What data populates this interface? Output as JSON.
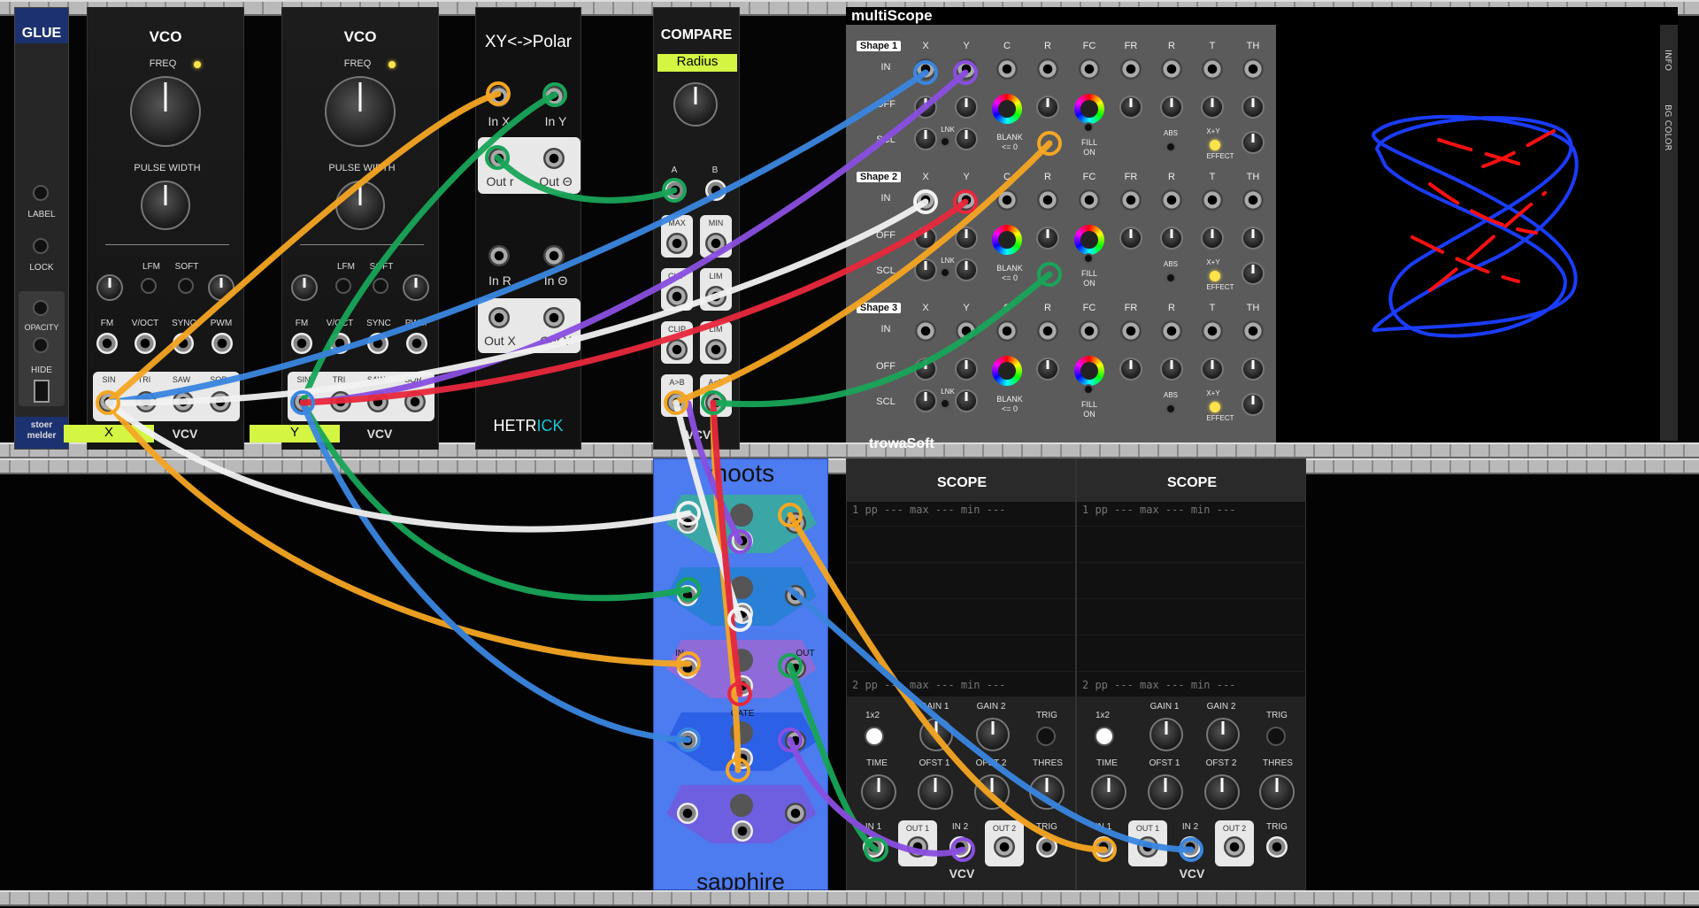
{
  "glue": {
    "title": "GLUE",
    "label": "LABEL",
    "lock": "LOCK",
    "opacity": "OPACITY",
    "hide": "HIDE",
    "brand_top": "stoer",
    "brand_bottom": "melder"
  },
  "vco1": {
    "title": "VCO",
    "freq": "FREQ",
    "pulse_width": "PULSE WIDTH",
    "lfm": "LFM",
    "soft": "SOFT",
    "inputs": [
      "FM",
      "V/OCT",
      "SYNC",
      "PWM"
    ],
    "outputs": [
      "SIN",
      "TRI",
      "SAW",
      "SQR"
    ],
    "tag": "X",
    "brand": "VCV"
  },
  "vco2": {
    "title": "VCO",
    "freq": "FREQ",
    "pulse_width": "PULSE WIDTH",
    "lfm": "LFM",
    "soft": "SOFT",
    "inputs": [
      "FM",
      "V/OCT",
      "SYNC",
      "PWM"
    ],
    "outputs": [
      "SIN",
      "TRI",
      "SAW",
      "SQR"
    ],
    "tag": "Y",
    "brand": "VCV"
  },
  "xypolar": {
    "title": "XY<->Polar",
    "in_x": "In X",
    "in_y": "In Y",
    "out_r": "Out r",
    "out_theta": "Out Θ",
    "in_r": "In R",
    "in_theta": "In Θ",
    "out_x": "Out X",
    "out_y": "Out Y",
    "brand_a": "HETR",
    "brand_b": "ICK"
  },
  "compare": {
    "title": "COMPARE",
    "mode": "Radius",
    "a": "A",
    "b": "B",
    "rows": [
      [
        "MAX",
        "MIN"
      ],
      [
        "CLIP",
        "LIM"
      ],
      [
        "CLIP",
        "LIM"
      ],
      [
        "A>B",
        "A<B"
      ]
    ],
    "brand": "VCV"
  },
  "multiscope": {
    "title": "multiScope",
    "info": "INFO",
    "bgcolor": "BG COLOR",
    "columns": [
      "X",
      "Y",
      "C",
      "R",
      "FC",
      "FR",
      "R",
      "T",
      "TH"
    ],
    "shapes": [
      "Shape 1",
      "Shape 2",
      "Shape 3"
    ],
    "row_in": "IN",
    "row_off": "OFF",
    "row_scl": "SCL",
    "lnk": "LNK",
    "blank": "BLANK",
    "blank2": "<= 0",
    "fill": "FILL",
    "fill2": "ON",
    "abs": "ABS",
    "xy": "X+Y",
    "effect": "EFFECT"
  },
  "trowasoft": {
    "title": "trowaSoft"
  },
  "moots": {
    "title": "moots",
    "in": "IN",
    "out": "OUT",
    "gate": "GATE",
    "brand": "sapphire"
  },
  "scope1": {
    "title": "SCOPE",
    "stat1": "1 pp --- max --- min ---",
    "stat2": "2 pp --- max --- min ---",
    "mode": "1x2",
    "gain1": "GAIN 1",
    "gain2": "GAIN 2",
    "trig": "TRIG",
    "time": "TIME",
    "ofst1": "OFST 1",
    "ofst2": "OFST 2",
    "thres": "THRES",
    "in1": "IN 1",
    "out1": "OUT 1",
    "in2": "IN 2",
    "out2": "OUT 2",
    "trig_in": "TRIG",
    "brand": "VCV"
  },
  "scope2": {
    "title": "SCOPE",
    "stat1": "1 pp --- max --- min ---",
    "stat2": "2 pp --- max --- min ---",
    "mode": "1x2",
    "gain1": "GAIN 1",
    "gain2": "GAIN 2",
    "trig": "TRIG",
    "time": "TIME",
    "ofst1": "OFST 1",
    "ofst2": "OFST 2",
    "thres": "THRES",
    "in1": "IN 1",
    "out1": "OUT 1",
    "in2": "IN 2",
    "out2": "OUT 2",
    "trig_in": "TRIG",
    "brand": "VCV"
  },
  "cable_colors": {
    "orange": "#f5a623",
    "green": "#18a558",
    "blue": "#3a86e0",
    "purple": "#8a4fe0",
    "white": "#f2f2f2",
    "red": "#e8283c"
  },
  "display_colors": {
    "blue": "#1a3cff",
    "red": "#ff1010"
  }
}
